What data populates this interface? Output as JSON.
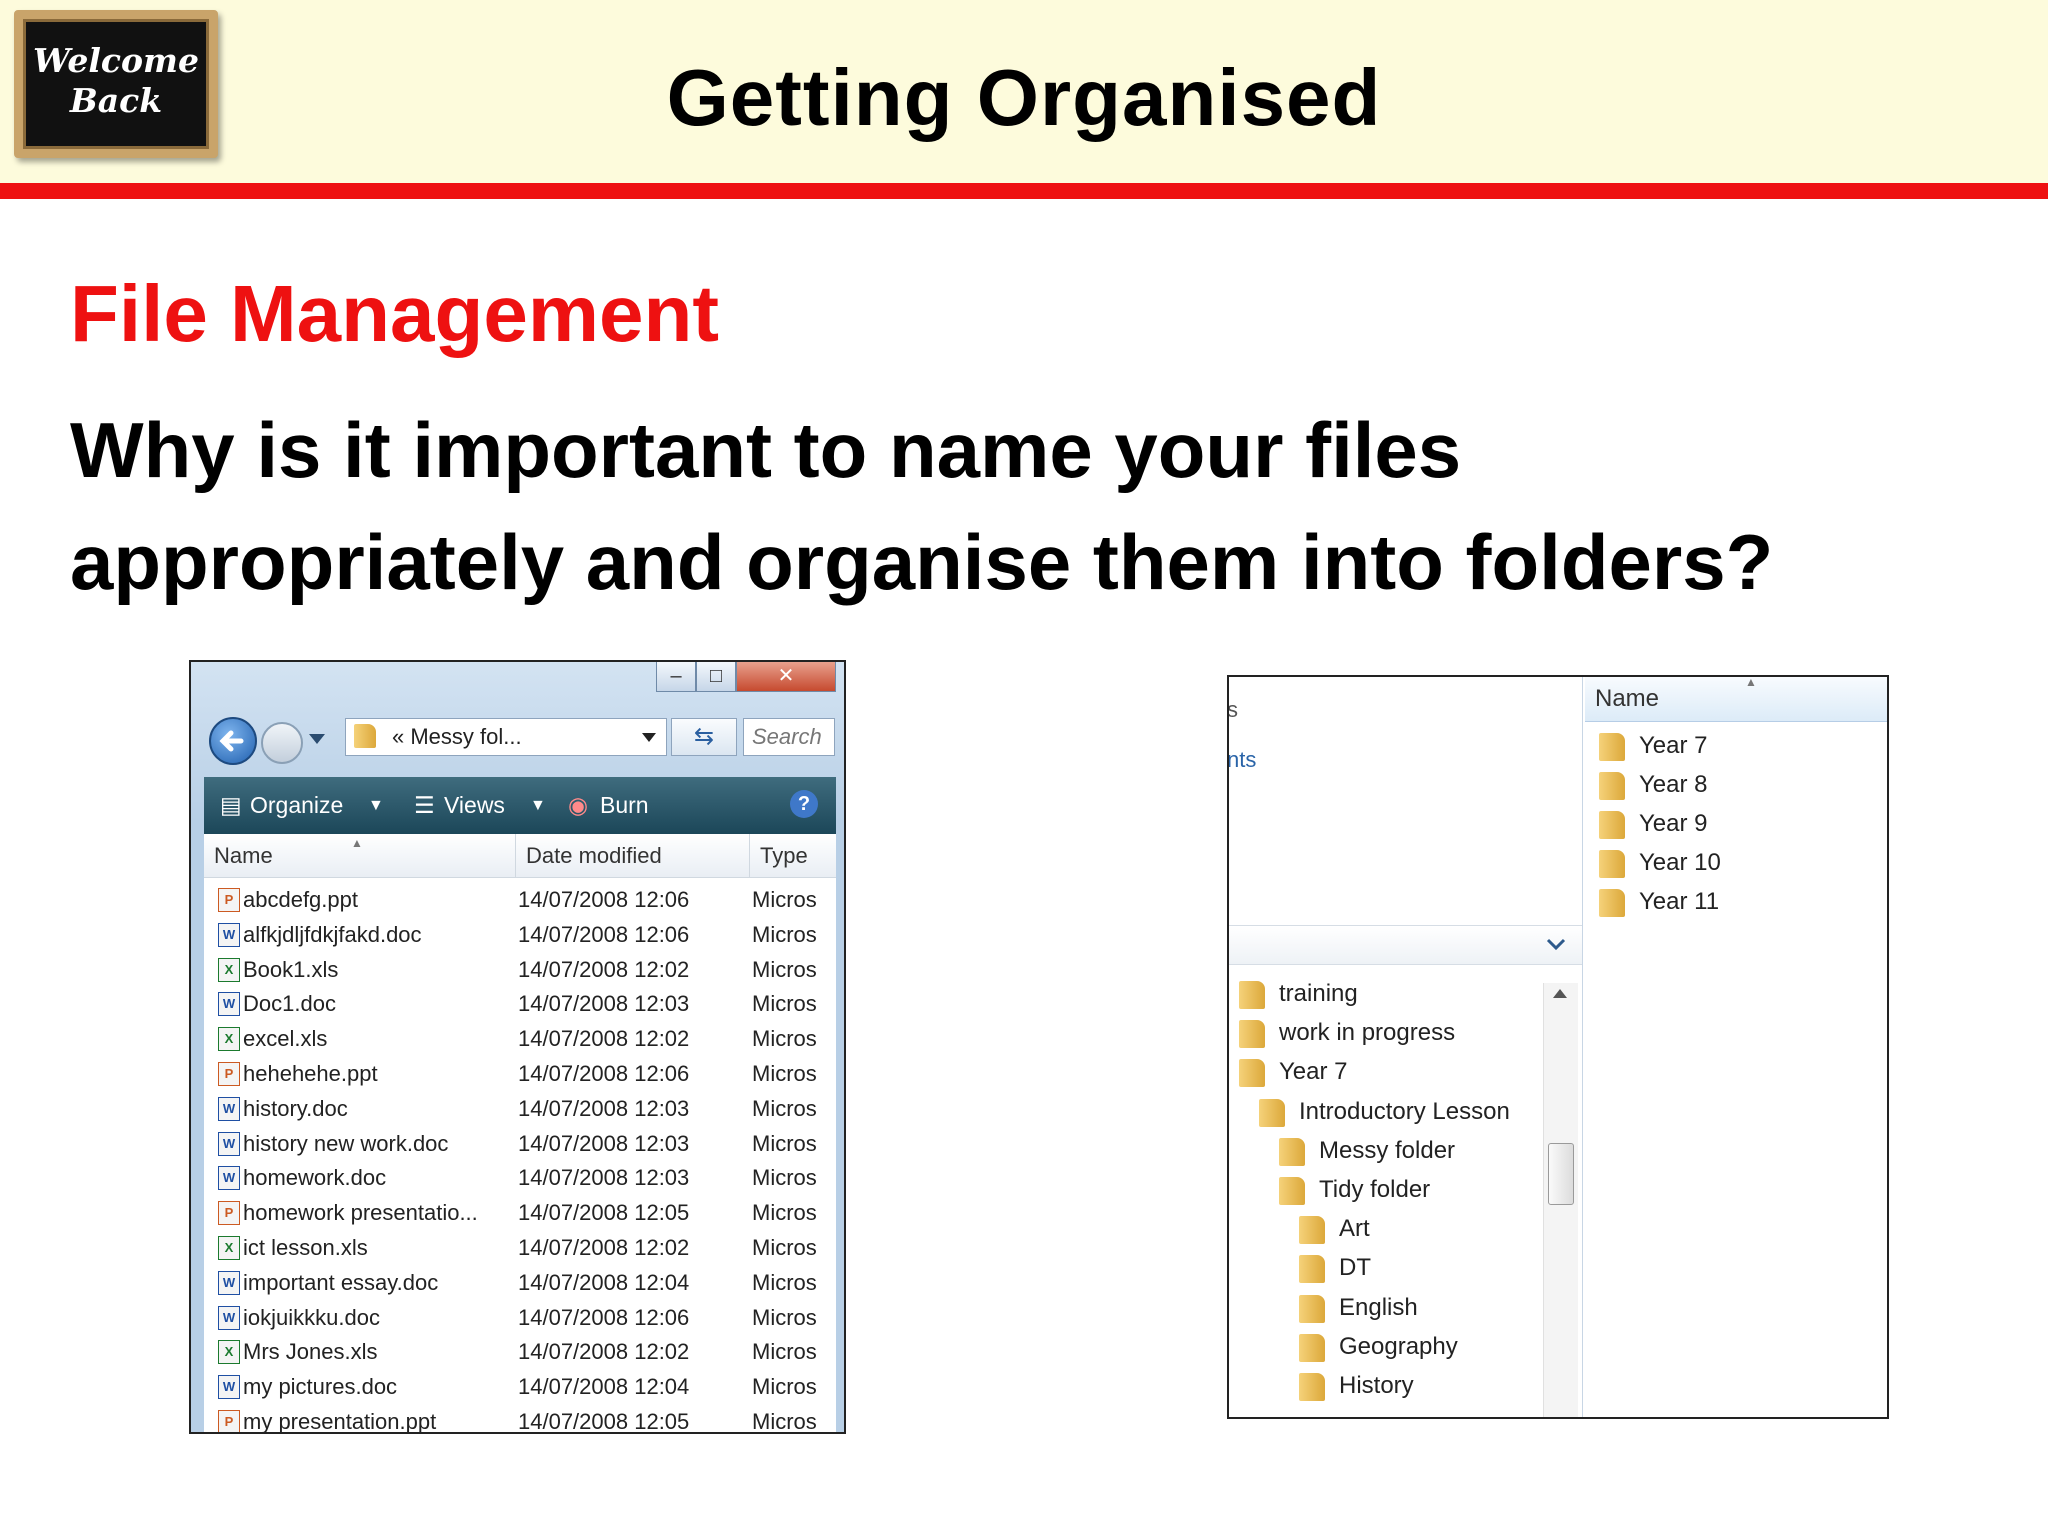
{
  "header": {
    "badge_line1": "Welcome",
    "badge_line2": "Back",
    "title": "Getting Organised"
  },
  "section_heading": "File Management",
  "question_line1": "Why is it important to name your files",
  "question_line2": "appropriately and organise them into folders?",
  "left_window": {
    "address": "« Messy fol...",
    "search_placeholder": "Search",
    "toolbar": {
      "organize": "Organize",
      "views": "Views",
      "burn": "Burn"
    },
    "columns": {
      "name": "Name",
      "date": "Date modified",
      "type": "Type"
    },
    "files": [
      {
        "name": "abcdefg.ppt",
        "date": "14/07/2008 12:06",
        "type": "Micros",
        "kind": "ppt"
      },
      {
        "name": "alfkjdljfdkjfakd.doc",
        "date": "14/07/2008 12:06",
        "type": "Micros",
        "kind": "doc"
      },
      {
        "name": "Book1.xls",
        "date": "14/07/2008 12:02",
        "type": "Micros",
        "kind": "xls"
      },
      {
        "name": "Doc1.doc",
        "date": "14/07/2008 12:03",
        "type": "Micros",
        "kind": "doc"
      },
      {
        "name": "excel.xls",
        "date": "14/07/2008 12:02",
        "type": "Micros",
        "kind": "xls"
      },
      {
        "name": "hehehehe.ppt",
        "date": "14/07/2008 12:06",
        "type": "Micros",
        "kind": "ppt"
      },
      {
        "name": "history.doc",
        "date": "14/07/2008 12:03",
        "type": "Micros",
        "kind": "doc"
      },
      {
        "name": "history new work.doc",
        "date": "14/07/2008 12:03",
        "type": "Micros",
        "kind": "doc"
      },
      {
        "name": "homework.doc",
        "date": "14/07/2008 12:03",
        "type": "Micros",
        "kind": "doc"
      },
      {
        "name": "homework presentatio...",
        "date": "14/07/2008 12:05",
        "type": "Micros",
        "kind": "ppt"
      },
      {
        "name": "ict lesson.xls",
        "date": "14/07/2008 12:02",
        "type": "Micros",
        "kind": "xls"
      },
      {
        "name": "important essay.doc",
        "date": "14/07/2008 12:04",
        "type": "Micros",
        "kind": "doc"
      },
      {
        "name": "iokjuikkku.doc",
        "date": "14/07/2008 12:06",
        "type": "Micros",
        "kind": "doc"
      },
      {
        "name": "Mrs Jones.xls",
        "date": "14/07/2008 12:02",
        "type": "Micros",
        "kind": "xls"
      },
      {
        "name": "my pictures.doc",
        "date": "14/07/2008 12:04",
        "type": "Micros",
        "kind": "doc"
      },
      {
        "name": "my presentation.ppt",
        "date": "14/07/2008 12:05",
        "type": "Micros",
        "kind": "ppt"
      }
    ]
  },
  "right_window": {
    "partial_labels": [
      "s",
      "nts"
    ],
    "list_header": "Name",
    "year_folders": [
      "Year 7",
      "Year 8",
      "Year 9",
      "Year 10",
      "Year 11"
    ],
    "tree": [
      {
        "label": "training",
        "level": 0
      },
      {
        "label": "work in progress",
        "level": 0
      },
      {
        "label": "Year 7",
        "level": 0
      },
      {
        "label": "Introductory Lesson",
        "level": 1
      },
      {
        "label": "Messy folder",
        "level": 2
      },
      {
        "label": "Tidy folder",
        "level": 2
      },
      {
        "label": "Art",
        "level": 3
      },
      {
        "label": "DT",
        "level": 3
      },
      {
        "label": "English",
        "level": 3
      },
      {
        "label": "Geography",
        "level": 3
      },
      {
        "label": "History",
        "level": 3
      }
    ]
  },
  "colors": {
    "accent_red": "#ee1111",
    "header_bg": "#fdfbdc"
  }
}
